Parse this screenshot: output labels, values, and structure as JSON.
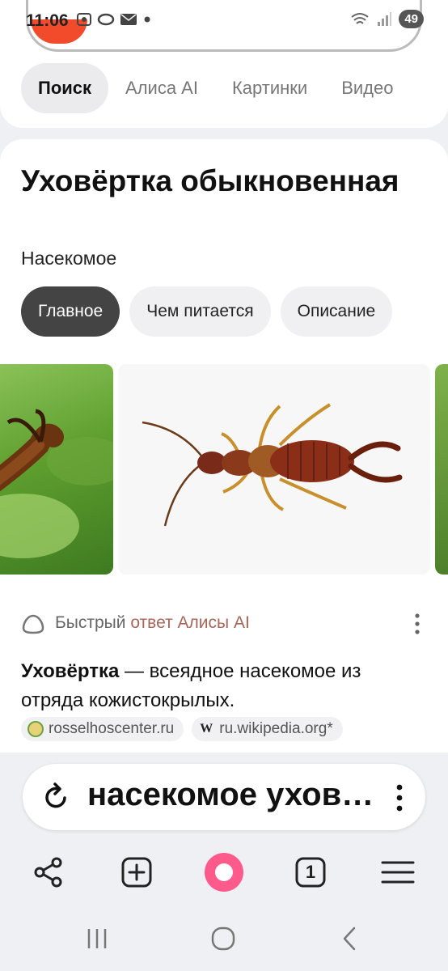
{
  "status_bar": {
    "time": "11:06",
    "battery": "49"
  },
  "tabs": [
    {
      "label": "Поиск",
      "active": true
    },
    {
      "label": "Алиса AI",
      "active": false
    },
    {
      "label": "Картинки",
      "active": false
    },
    {
      "label": "Видео",
      "active": false
    }
  ],
  "entity": {
    "title": "Уховёртка обыкновенная",
    "subtitle": "Насекомое",
    "chips": [
      {
        "label": "Главное",
        "active": true
      },
      {
        "label": "Чем питается",
        "active": false
      },
      {
        "label": "Описание",
        "active": false
      }
    ]
  },
  "alice": {
    "prefix": "Быстрый ",
    "brand": "ответ Алисы AI",
    "answer_bold": "Уховёртка",
    "answer_rest": " — всеядное насекомое из отряда кожистокрылых.",
    "sources": [
      {
        "label": "rosselhoscenter.ru",
        "icon": "rosselhoscenter-icon"
      },
      {
        "label": "ru.wikipedia.org*",
        "icon": "wikipedia-icon",
        "glyph": "W"
      }
    ]
  },
  "query_bar": {
    "text": "насекомое уховёртка"
  },
  "toolbar": {
    "tabs_count": "1"
  },
  "colors": {
    "alice_accent": "#ff5a8c",
    "chip_active": "#444444",
    "brand_text": "#a6665a"
  }
}
